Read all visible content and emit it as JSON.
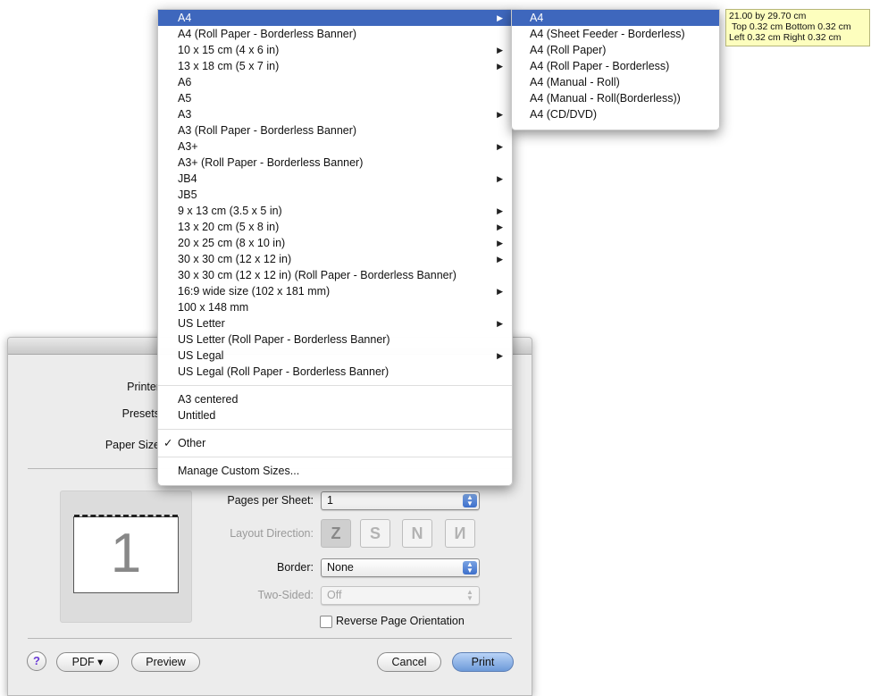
{
  "dialog": {
    "labels": {
      "printer": "Printer",
      "presets": "Presets",
      "paper_size": "Paper Size"
    },
    "pages_per_sheet": {
      "label": "Pages per Sheet:",
      "value": "1"
    },
    "layout_direction": {
      "label": "Layout Direction:"
    },
    "border": {
      "label": "Border:",
      "value": "None"
    },
    "two_sided": {
      "label": "Two-Sided:",
      "value": "Off"
    },
    "reverse_orientation": {
      "label": "Reverse Page Orientation",
      "checked": false
    },
    "preview_page_number": "1",
    "buttons": {
      "help": "?",
      "pdf": "PDF ▾",
      "preview": "Preview",
      "cancel": "Cancel",
      "print": "Print"
    }
  },
  "paper_menu": {
    "items": [
      {
        "label": "A4",
        "submenu": true,
        "highlighted": true
      },
      {
        "label": "A4 (Roll Paper - Borderless Banner)",
        "submenu": false
      },
      {
        "label": "10 x 15 cm (4 x 6 in)",
        "submenu": true
      },
      {
        "label": "13 x 18 cm (5 x 7 in)",
        "submenu": true
      },
      {
        "label": "A6",
        "submenu": false
      },
      {
        "label": "A5",
        "submenu": false
      },
      {
        "label": "A3",
        "submenu": true
      },
      {
        "label": "A3 (Roll Paper - Borderless Banner)",
        "submenu": false
      },
      {
        "label": "A3+",
        "submenu": true
      },
      {
        "label": "A3+ (Roll Paper - Borderless Banner)",
        "submenu": false
      },
      {
        "label": "JB4",
        "submenu": true
      },
      {
        "label": "JB5",
        "submenu": false
      },
      {
        "label": "9 x 13 cm (3.5 x 5 in)",
        "submenu": true
      },
      {
        "label": "13 x 20 cm (5 x 8 in)",
        "submenu": true
      },
      {
        "label": "20 x 25 cm (8 x 10 in)",
        "submenu": true
      },
      {
        "label": "30 x 30 cm (12 x 12 in)",
        "submenu": true
      },
      {
        "label": "30 x 30 cm (12 x 12 in) (Roll Paper - Borderless Banner)",
        "submenu": false
      },
      {
        "label": "16:9 wide size (102 x 181 mm)",
        "submenu": true
      },
      {
        "label": "100 x 148 mm",
        "submenu": false
      },
      {
        "label": "US Letter",
        "submenu": true
      },
      {
        "label": "US Letter (Roll Paper - Borderless Banner)",
        "submenu": false
      },
      {
        "label": "US Legal",
        "submenu": true
      },
      {
        "label": "US Legal (Roll Paper - Borderless Banner)",
        "submenu": false
      }
    ],
    "custom_items": [
      {
        "label": "A3 centered"
      },
      {
        "label": "Untitled"
      }
    ],
    "other": {
      "label": "Other",
      "check": "✓"
    },
    "manage_custom_sizes": "Manage Custom Sizes..."
  },
  "a4_submenu": {
    "items": [
      {
        "label": "A4",
        "highlighted": true
      },
      {
        "label": "A4 (Sheet Feeder - Borderless)"
      },
      {
        "label": "A4 (Roll Paper)"
      },
      {
        "label": "A4 (Roll Paper - Borderless)"
      },
      {
        "label": "A4 (Manual - Roll)"
      },
      {
        "label": "A4 (Manual - Roll(Borderless))"
      },
      {
        "label": "A4 (CD/DVD)"
      }
    ]
  },
  "tooltip": {
    "line1": "21.00 by 29.70 cm",
    "line2": "Top 0.32 cm Bottom 0.32 cm",
    "line3": "Left 0.32 cm Right 0.32 cm"
  },
  "colors": {
    "highlight": "#3e67bd",
    "tooltip_bg": "#fdfebe",
    "help_icon": "#6b3bd6"
  }
}
